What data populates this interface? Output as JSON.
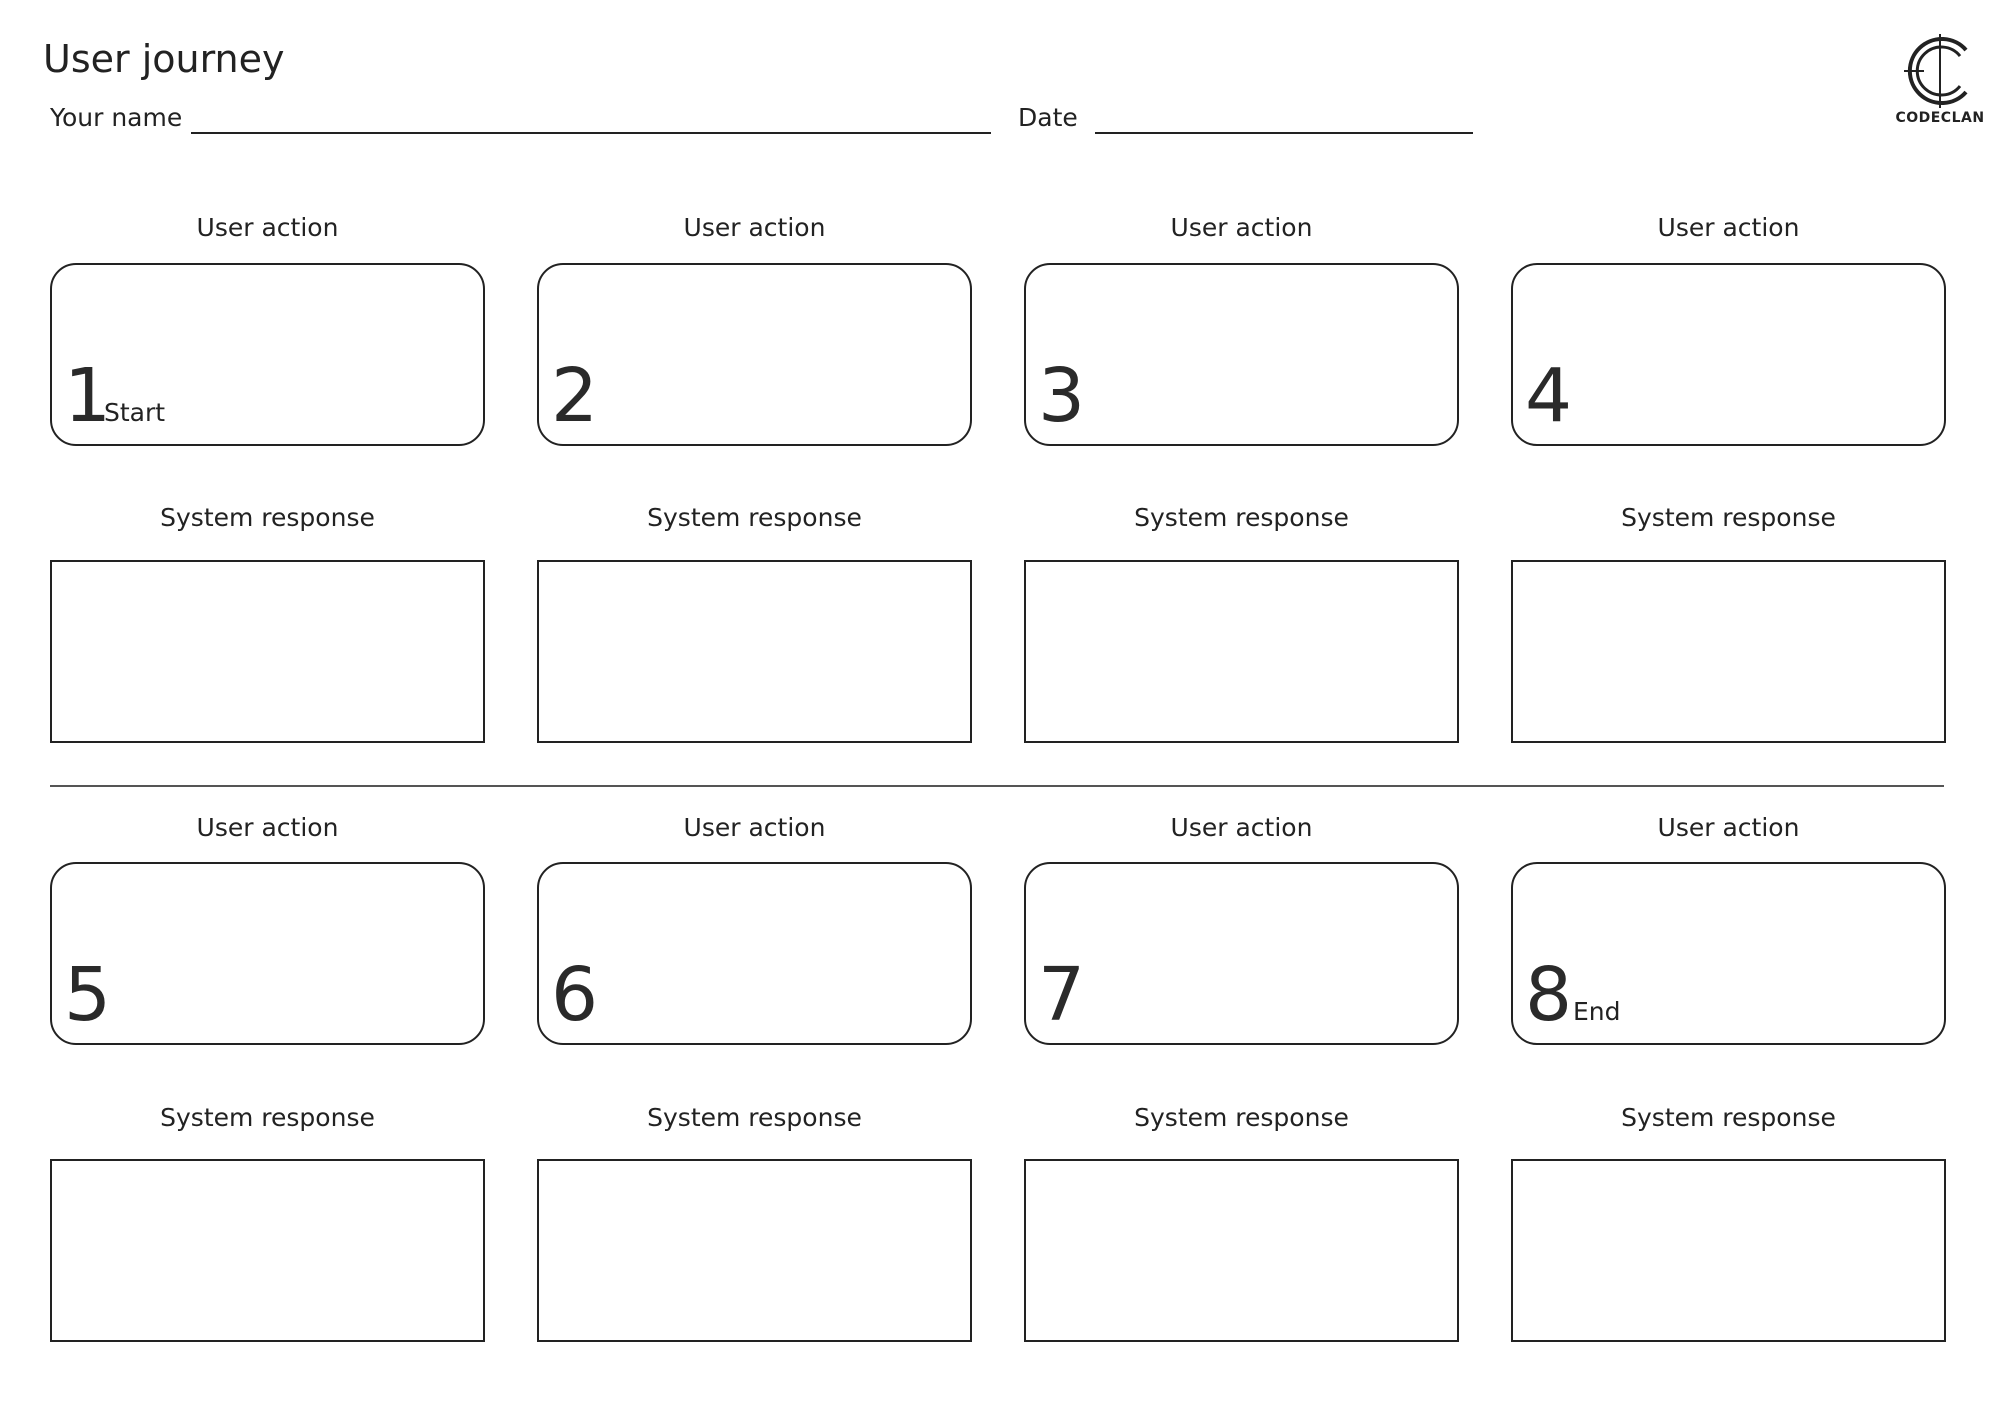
{
  "header": {
    "title": "User journey",
    "name_label": "Your name",
    "date_label": "Date"
  },
  "logo": {
    "text": "CODECLAN",
    "icon": "codeclan-c-icon"
  },
  "labels": {
    "user_action": "User action",
    "system_response": "System response"
  },
  "steps": [
    {
      "number": "1",
      "note": "Start"
    },
    {
      "number": "2",
      "note": ""
    },
    {
      "number": "3",
      "note": ""
    },
    {
      "number": "4",
      "note": ""
    },
    {
      "number": "5",
      "note": ""
    },
    {
      "number": "6",
      "note": ""
    },
    {
      "number": "7",
      "note": ""
    },
    {
      "number": "8",
      "note": "End"
    }
  ]
}
